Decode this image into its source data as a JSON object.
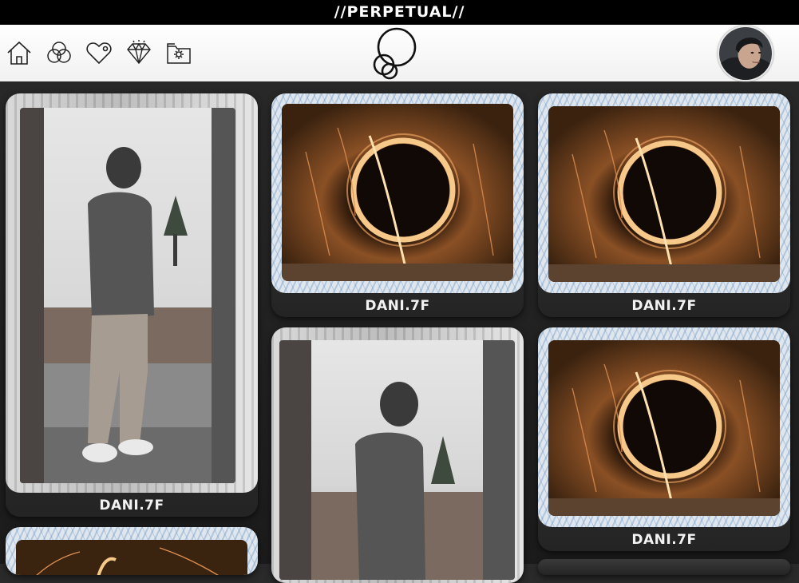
{
  "header": {
    "banner_title": "//PERPETUAL//"
  },
  "nav": {
    "items": [
      {
        "icon": "home-icon"
      },
      {
        "icon": "venn-circles-icon"
      },
      {
        "icon": "heart-icon"
      },
      {
        "icon": "diamond-icon"
      },
      {
        "icon": "folder-icon"
      }
    ],
    "logo": "circles-logo",
    "profile": "user-avatar"
  },
  "gallery": {
    "cards": [
      {
        "label": "DANI.7F",
        "photo": "man-in-doorway"
      },
      {
        "label": "DANI.7F",
        "photo": "steel-wool-ring"
      },
      {
        "label": "DANI.7F",
        "photo": "steel-wool-ring"
      },
      {
        "label": "",
        "photo": "man-in-doorway"
      },
      {
        "label": "DANI.7F",
        "photo": "steel-wool-ring"
      },
      {
        "label": "",
        "photo": "steel-wool-ring"
      }
    ]
  },
  "colors": {
    "banner_bg": "#000000",
    "navbar_bg": "#ffffff",
    "page_bg": "#222222",
    "card_bg": "#2e2e2e",
    "label_text": "#f2f2f2",
    "spark": "#f0a050"
  }
}
